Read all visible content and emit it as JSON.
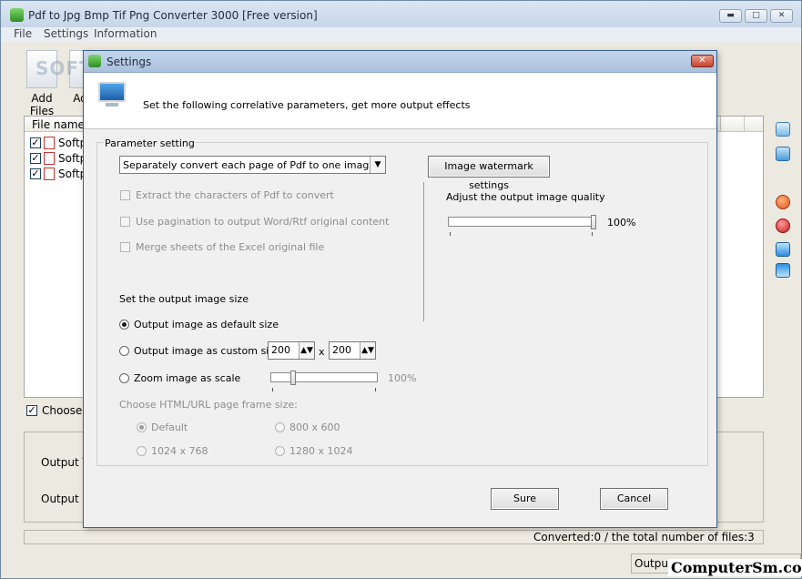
{
  "main_window": {
    "title": "Pdf to Jpg Bmp Tif Png Converter 3000 [Free version]",
    "controls": {
      "minimize": "▬",
      "maximize": "□",
      "close": "✕"
    },
    "menu": [
      "File",
      "Settings",
      "Information"
    ],
    "toolbar": {
      "add_files": "Add Files",
      "add_folder": "Ad"
    },
    "watermark": "SOFTPEDIA",
    "file_list": {
      "column_header": "File name",
      "rows": [
        {
          "checked": true,
          "name": "Softpe"
        },
        {
          "checked": true,
          "name": "Softpe"
        },
        {
          "checked": true,
          "name": "Softpe"
        }
      ]
    },
    "choose_label": "Choose a",
    "output_type_label": "Output Ty",
    "output_dir_label": "Output Dir",
    "converted_text": "Converted:0  /  the total number of files:3",
    "output_bottom": "Output",
    "site_watermark": "ComputerSm.com",
    "side_icons": [
      "list-icon",
      "add-folder-icon",
      "remove-icon",
      "delete-icon",
      "move-up-icon",
      "move-down-icon"
    ]
  },
  "dialog": {
    "title": "Settings",
    "close_glyph": "✕",
    "header_text": "Set the following correlative parameters, get more output effects",
    "group_label": "Parameter setting",
    "convert_mode": "Separately convert each page of Pdf to one image",
    "combo_arrow": "▼",
    "watermark_button": "Image watermark settings",
    "options": {
      "extract_chars": "Extract the characters of Pdf to convert",
      "pagination": "Use pagination to output Word/Rtf original content",
      "merge_sheets": "Merge sheets of the Excel original file"
    },
    "size_section": {
      "title": "Set the output image size",
      "default_size": "Output image as default size",
      "custom_size": "Output image as custom size",
      "width": "200",
      "x_sep": "x",
      "height": "200",
      "zoom": "Zoom image as scale",
      "zoom_percent": "100%",
      "zoom_level": 0.2
    },
    "html_frame": {
      "title": "Choose HTML/URL page frame size:",
      "default": "Default",
      "s800": "800 x 600",
      "s1024": "1024 x 768",
      "s1280": "1280 x 1024"
    },
    "quality": {
      "title": "Adjust the output image quality",
      "value": "100%",
      "level": 1.0
    },
    "ok": "Sure",
    "cancel": "Cancel",
    "spin_glyph": "▲▼"
  }
}
